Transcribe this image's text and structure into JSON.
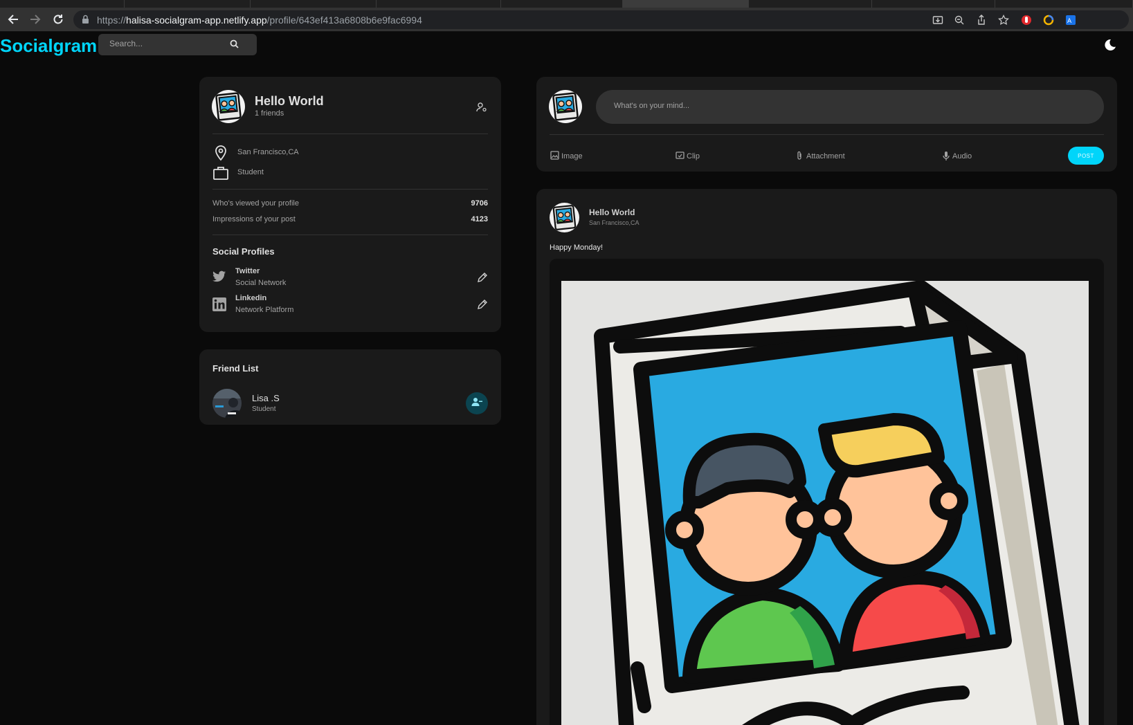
{
  "browser": {
    "url_prefix": "https://",
    "url_host": "halisa-socialgram-app.netlify.app",
    "url_path": "/profile/643ef413a6808b6e9fac6994"
  },
  "header": {
    "brand": "Socialgram",
    "search_placeholder": "Search..."
  },
  "profile": {
    "name": "Hello World",
    "friends_count": "1 friends",
    "location": "San Francisco,CA",
    "occupation": "Student",
    "stats": [
      {
        "label": "Who's viewed your profile",
        "value": "9706"
      },
      {
        "label": "Impressions of your post",
        "value": "4123"
      }
    ],
    "social_title": "Social Profiles",
    "socials": [
      {
        "name": "Twitter",
        "desc": "Social Network"
      },
      {
        "name": "Linkedin",
        "desc": "Network Platform"
      }
    ]
  },
  "friend_list": {
    "title": "Friend List",
    "friends": [
      {
        "name": "Lisa .S",
        "occupation": "Student"
      }
    ]
  },
  "composer": {
    "placeholder": "What's on your mind...",
    "actions": [
      "Image",
      "Clip",
      "Attachment",
      "Audio"
    ],
    "post_label": "POST"
  },
  "post": {
    "author": "Hello World",
    "location": "San Francisco,CA",
    "text": "Happy Monday!"
  },
  "colors": {
    "accent": "#00d5fa",
    "background": "#0a0a0a",
    "card": "#1a1a1a"
  }
}
